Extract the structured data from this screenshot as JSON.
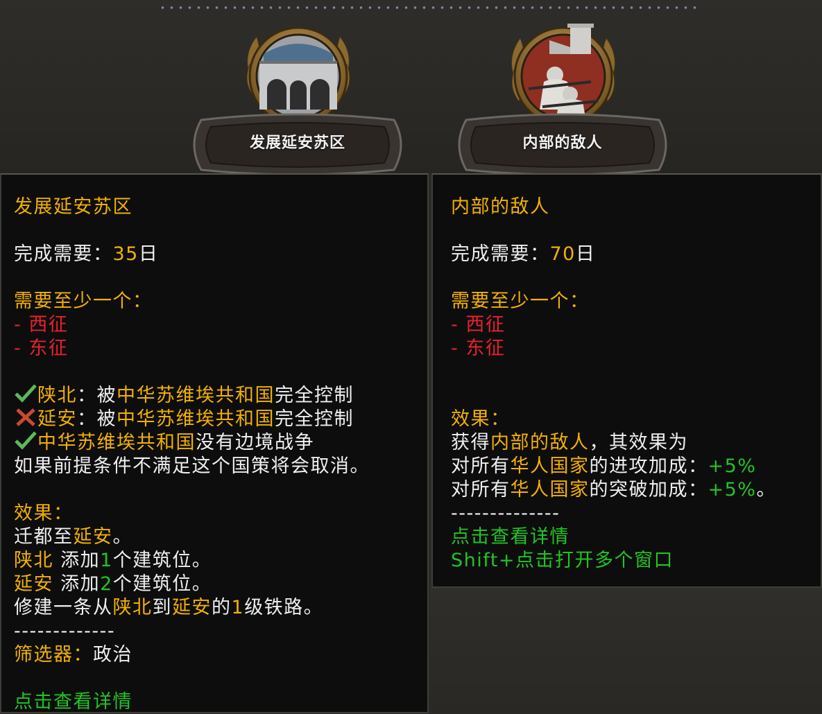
{
  "focuses": [
    {
      "name": "发展延安苏区",
      "icon": "cave-dwelling-icon"
    },
    {
      "name": "内部的敌人",
      "icon": "soldiers-great-wall-icon"
    }
  ],
  "left_tooltip": {
    "title": "发展延安苏区",
    "time_label": "完成需要：",
    "time_value": "35",
    "time_unit": "日",
    "requires_label": "需要至少一个：",
    "requires": [
      "- 西征",
      "- 东征"
    ],
    "conditions": [
      {
        "status": "met",
        "state": "陕北",
        "sep": "：被",
        "country": "中华苏维埃共和国",
        "tail": "完全控制"
      },
      {
        "status": "unmet",
        "state": "延安",
        "sep": "：被",
        "country": "中华苏维埃共和国",
        "tail": "完全控制"
      },
      {
        "status": "met",
        "country": "中华苏维埃共和国",
        "tail": "没有边境战争"
      }
    ],
    "cancel_note": "如果前提条件不满足这个国策将会取消。",
    "effects_label": "效果：",
    "effect1_pre": "迁都至",
    "effect1_state": "延安",
    "effect1_post": "。",
    "effect2_state": "陕北",
    "effect2_mid": " 添加",
    "effect2_num": "1",
    "effect2_post": "个建筑位。",
    "effect3_state": "延安",
    "effect3_mid": " 添加",
    "effect3_num": "2",
    "effect3_post": "个建筑位。",
    "effect4_pre": "修建一条从",
    "effect4_a": "陕北",
    "effect4_to": "到",
    "effect4_b": "延安",
    "effect4_of": "的",
    "effect4_num": "1",
    "effect4_post": "级铁路。",
    "divider": "-------------",
    "filter_label": "筛选器：",
    "filter_value": "政治",
    "click_hint": "点击查看详情"
  },
  "right_tooltip": {
    "title": "内部的敌人",
    "time_label": "完成需要：",
    "time_value": "70",
    "time_unit": "日",
    "requires_label": "需要至少一个：",
    "requires": [
      "- 西征",
      "- 东征"
    ],
    "effects_label": "效果：",
    "effect1_pre": "获得",
    "effect1_spirit": "内部的敌人",
    "effect1_post": "，其效果为",
    "effect2_pre": "对所有",
    "effect2_target": "华人国家",
    "effect2_mid": "的进攻加成：",
    "effect2_value": "+5%",
    "effect3_pre": "对所有",
    "effect3_target": "华人国家",
    "effect3_mid": "的突破加成：",
    "effect3_value": "+5%",
    "effect3_post": "。",
    "divider": "--------------",
    "click_hint": "点击查看详情",
    "shift_hint": "Shift+点击打开多个窗口"
  }
}
